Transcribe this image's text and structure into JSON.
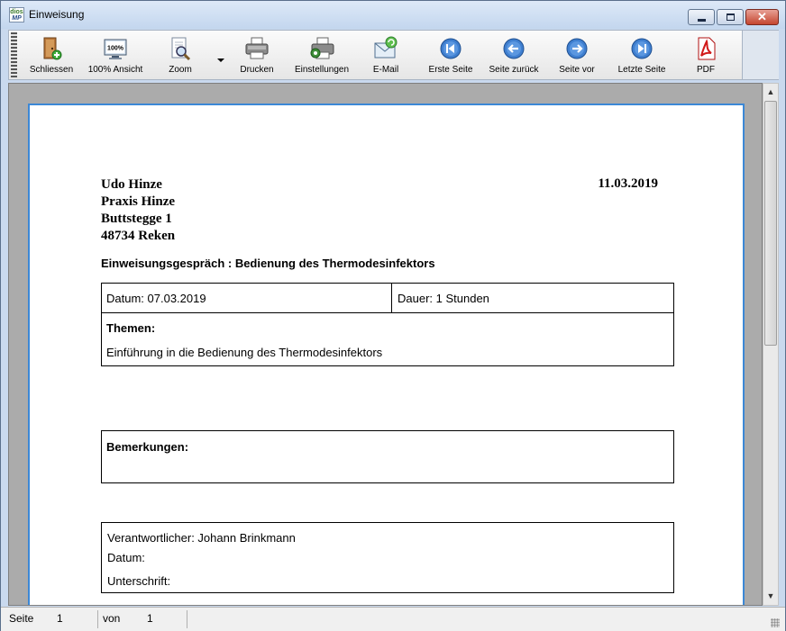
{
  "window": {
    "title": "Einweisung",
    "app_icon_text_top": "dios",
    "app_icon_text_bottom": "MP"
  },
  "toolbar": {
    "buttons": [
      {
        "id": "schliessen",
        "label": "Schliessen",
        "icon": "door-exit-icon"
      },
      {
        "id": "ansicht",
        "label": "100% Ansicht",
        "icon": "monitor-100-icon"
      },
      {
        "id": "zoom",
        "label": "Zoom",
        "icon": "zoom-icon"
      },
      {
        "id": "drucken",
        "label": "Drucken",
        "icon": "printer-icon"
      },
      {
        "id": "einstellungen",
        "label": "Einstellungen",
        "icon": "printer-settings-icon"
      },
      {
        "id": "email",
        "label": "E-Mail",
        "icon": "email-icon"
      },
      {
        "id": "erste",
        "label": "Erste Seite",
        "icon": "first-page-icon"
      },
      {
        "id": "zurueck",
        "label": "Seite zurück",
        "icon": "previous-page-icon"
      },
      {
        "id": "vor",
        "label": "Seite vor",
        "icon": "next-page-icon"
      },
      {
        "id": "letzte",
        "label": "Letzte Seite",
        "icon": "last-page-icon"
      },
      {
        "id": "pdf",
        "label": "PDF",
        "icon": "pdf-icon"
      }
    ]
  },
  "document": {
    "address": [
      "Udo Hinze",
      "Praxis Hinze",
      "Buttstegge 1",
      "48734 Reken"
    ],
    "date": "11.03.2019",
    "subject": "Einweisungsgespräch : Bedienung des Thermodesinfektors",
    "datum": "Datum: 07.03.2019",
    "dauer": "Dauer:  1  Stunden",
    "themen_heading": "Themen:",
    "themen_text": "Einführung in die Bedienung des Thermodesinfektors",
    "bemerkungen_heading": "Bemerkungen:",
    "verantwortlicher": "Verantwortlicher: Johann Brinkmann",
    "sign_datum": "Datum:",
    "unterschrift": "Unterschrift:"
  },
  "status": {
    "seite_label": "Seite",
    "seite_value": "1",
    "von_label": "von",
    "von_value": "1"
  }
}
